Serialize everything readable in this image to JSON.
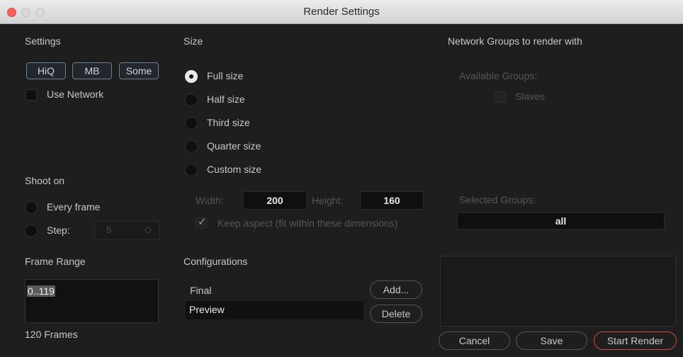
{
  "window": {
    "title": "Render Settings"
  },
  "settings": {
    "heading": "Settings",
    "toggles": [
      "HiQ",
      "MB",
      "Some"
    ],
    "use_network_label": "Use Network"
  },
  "shoot_on": {
    "heading": "Shoot on",
    "every_frame_label": "Every frame",
    "step_label": "Step:",
    "step_value": "5"
  },
  "frame_range": {
    "heading": "Frame Range",
    "value": "0..119",
    "frames_summary": "120 Frames"
  },
  "size": {
    "heading": "Size",
    "options": [
      "Full size",
      "Half size",
      "Third size",
      "Quarter size",
      "Custom size"
    ],
    "selected": "Full size",
    "width_label": "Width:",
    "width_value": "200",
    "height_label": "Height:",
    "height_value": "160",
    "keep_aspect_label": "Keep aspect (fit within these dimensions)"
  },
  "configurations": {
    "heading": "Configurations",
    "items": [
      "Final",
      "Preview"
    ],
    "selected": "Preview",
    "add_label": "Add...",
    "delete_label": "Delete"
  },
  "network_groups": {
    "heading": "Network Groups to render with",
    "available_label": "Available Groups:",
    "available_items": [
      "Slaves"
    ],
    "selected_label": "Selected Groups:",
    "selected_value": "all"
  },
  "actions": {
    "cancel": "Cancel",
    "save": "Save",
    "start_render": "Start Render"
  }
}
